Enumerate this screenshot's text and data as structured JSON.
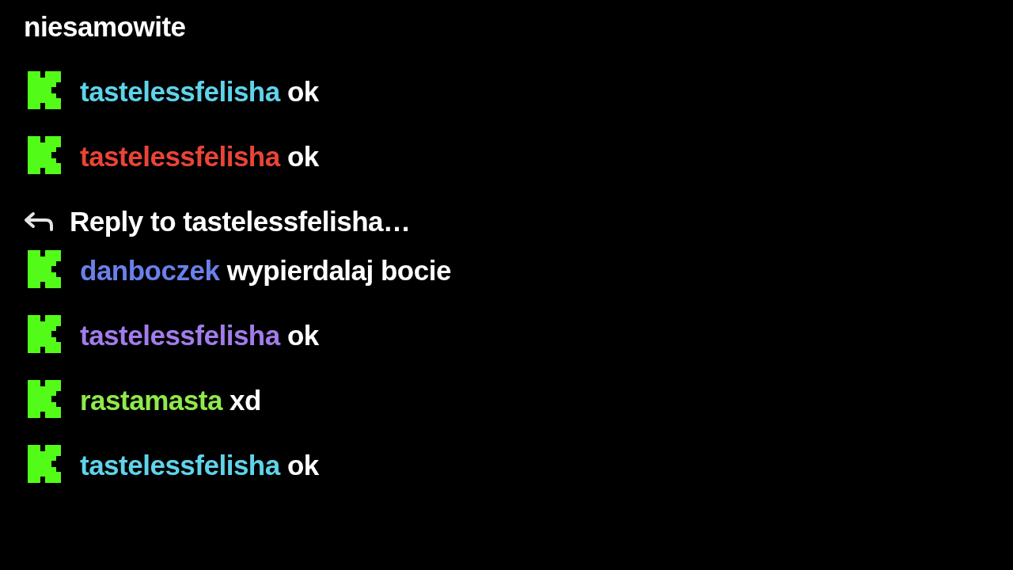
{
  "continuation": {
    "text": "niesamowite"
  },
  "messages": [
    {
      "username": "tastelessfelisha",
      "color": "#5fd3ea",
      "text": "ok"
    },
    {
      "username": "tastelessfelisha",
      "color": "#ea4437",
      "text": "ok"
    },
    {
      "reply_to": "Reply to tastelessfelisha…",
      "username": "danboczek",
      "color": "#6a80ea",
      "text": "wypierdalaj bocie"
    },
    {
      "username": "tastelessfelisha",
      "color": "#a27cea",
      "text": "ok"
    },
    {
      "username": "rastamasta",
      "color": "#8fea4c",
      "text": "xd"
    },
    {
      "username": "tastelessfelisha",
      "color": "#5fd3ea",
      "text": "ok"
    }
  ]
}
